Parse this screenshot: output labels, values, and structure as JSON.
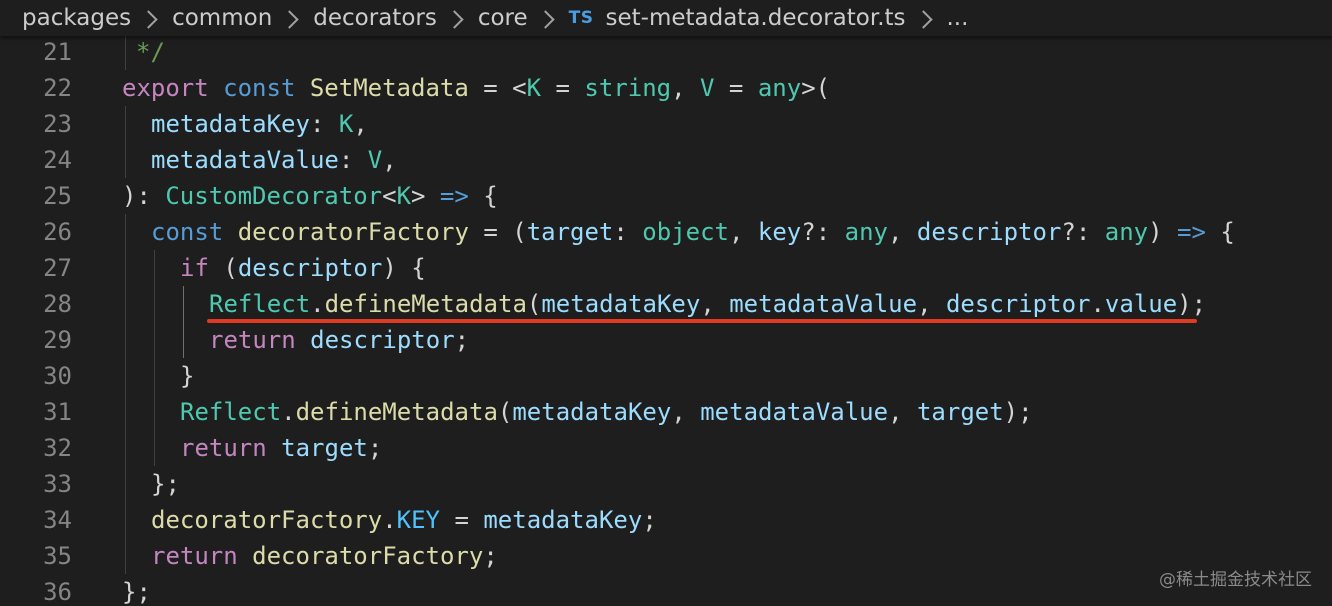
{
  "breadcrumb": {
    "items": [
      "packages",
      "common",
      "decorators",
      "core"
    ],
    "file_icon": "TS",
    "file_name": "set-metadata.decorator.ts",
    "overflow": "..."
  },
  "editor": {
    "underline_color": "#e03a22",
    "lines": [
      {
        "n": "21",
        "tokens": [
          [
            "cm",
            "*/"
          ]
        ]
      },
      {
        "n": "22",
        "tokens": [
          [
            "ctl",
            "export"
          ],
          [
            "pn",
            " "
          ],
          [
            "kw",
            "const"
          ],
          [
            "pn",
            " "
          ],
          [
            "fn",
            "SetMetadata"
          ],
          [
            "pn",
            " = <"
          ],
          [
            "ty",
            "K"
          ],
          [
            "pn",
            " = "
          ],
          [
            "ty",
            "string"
          ],
          [
            "pn",
            ", "
          ],
          [
            "ty",
            "V"
          ],
          [
            "pn",
            " = "
          ],
          [
            "ty",
            "any"
          ],
          [
            "pn",
            ">("
          ]
        ]
      },
      {
        "n": "23",
        "tokens": [
          [
            "var",
            "metadataKey"
          ],
          [
            "pn",
            ": "
          ],
          [
            "ty",
            "K"
          ],
          [
            "pn",
            ","
          ]
        ]
      },
      {
        "n": "24",
        "tokens": [
          [
            "var",
            "metadataValue"
          ],
          [
            "pn",
            ": "
          ],
          [
            "ty",
            "V"
          ],
          [
            "pn",
            ","
          ]
        ]
      },
      {
        "n": "25",
        "tokens": [
          [
            "pn",
            "): "
          ],
          [
            "ty",
            "CustomDecorator"
          ],
          [
            "pn",
            "<"
          ],
          [
            "ty",
            "K"
          ],
          [
            "pn",
            "> "
          ],
          [
            "kw",
            "=>"
          ],
          [
            "pn",
            " {"
          ]
        ]
      },
      {
        "n": "26",
        "tokens": [
          [
            "kw",
            "const"
          ],
          [
            "pn",
            " "
          ],
          [
            "fn",
            "decoratorFactory"
          ],
          [
            "pn",
            " = ("
          ],
          [
            "var",
            "target"
          ],
          [
            "pn",
            ": "
          ],
          [
            "ty",
            "object"
          ],
          [
            "pn",
            ", "
          ],
          [
            "var",
            "key"
          ],
          [
            "pn",
            "?: "
          ],
          [
            "ty",
            "any"
          ],
          [
            "pn",
            ", "
          ],
          [
            "var",
            "descriptor"
          ],
          [
            "pn",
            "?: "
          ],
          [
            "ty",
            "any"
          ],
          [
            "pn",
            ") "
          ],
          [
            "kw",
            "=>"
          ],
          [
            "pn",
            " {"
          ]
        ]
      },
      {
        "n": "27",
        "tokens": [
          [
            "ctl",
            "if"
          ],
          [
            "pn",
            " ("
          ],
          [
            "var",
            "descriptor"
          ],
          [
            "pn",
            ") {"
          ]
        ]
      },
      {
        "n": "28",
        "tokens": [
          [
            "ty",
            "Reflect"
          ],
          [
            "pn",
            "."
          ],
          [
            "fn",
            "defineMetadata"
          ],
          [
            "pn",
            "("
          ],
          [
            "var",
            "metadataKey"
          ],
          [
            "pn",
            ", "
          ],
          [
            "var",
            "metadataValue"
          ],
          [
            "pn",
            ", "
          ],
          [
            "var",
            "descriptor"
          ],
          [
            "pn",
            "."
          ],
          [
            "var",
            "value"
          ],
          [
            "pn",
            ");"
          ]
        ]
      },
      {
        "n": "29",
        "tokens": [
          [
            "ctl",
            "return"
          ],
          [
            "pn",
            " "
          ],
          [
            "var",
            "descriptor"
          ],
          [
            "pn",
            ";"
          ]
        ]
      },
      {
        "n": "30",
        "tokens": [
          [
            "pn",
            "}"
          ]
        ]
      },
      {
        "n": "31",
        "tokens": [
          [
            "ty",
            "Reflect"
          ],
          [
            "pn",
            "."
          ],
          [
            "fn",
            "defineMetadata"
          ],
          [
            "pn",
            "("
          ],
          [
            "var",
            "metadataKey"
          ],
          [
            "pn",
            ", "
          ],
          [
            "var",
            "metadataValue"
          ],
          [
            "pn",
            ", "
          ],
          [
            "var",
            "target"
          ],
          [
            "pn",
            ");"
          ]
        ]
      },
      {
        "n": "32",
        "tokens": [
          [
            "ctl",
            "return"
          ],
          [
            "pn",
            " "
          ],
          [
            "var",
            "target"
          ],
          [
            "pn",
            ";"
          ]
        ]
      },
      {
        "n": "33",
        "tokens": [
          [
            "pn",
            "};"
          ]
        ]
      },
      {
        "n": "34",
        "tokens": [
          [
            "fn",
            "decoratorFactory"
          ],
          [
            "pn",
            "."
          ],
          [
            "cst",
            "KEY"
          ],
          [
            "pn",
            " = "
          ],
          [
            "var",
            "metadataKey"
          ],
          [
            "pn",
            ";"
          ]
        ]
      },
      {
        "n": "35",
        "tokens": [
          [
            "ctl",
            "return"
          ],
          [
            "pn",
            " "
          ],
          [
            "fn",
            "decoratorFactory"
          ],
          [
            "pn",
            ";"
          ]
        ]
      },
      {
        "n": "36",
        "tokens": [
          [
            "pn",
            "};"
          ]
        ]
      }
    ]
  },
  "watermark": "@稀土掘金技术社区"
}
